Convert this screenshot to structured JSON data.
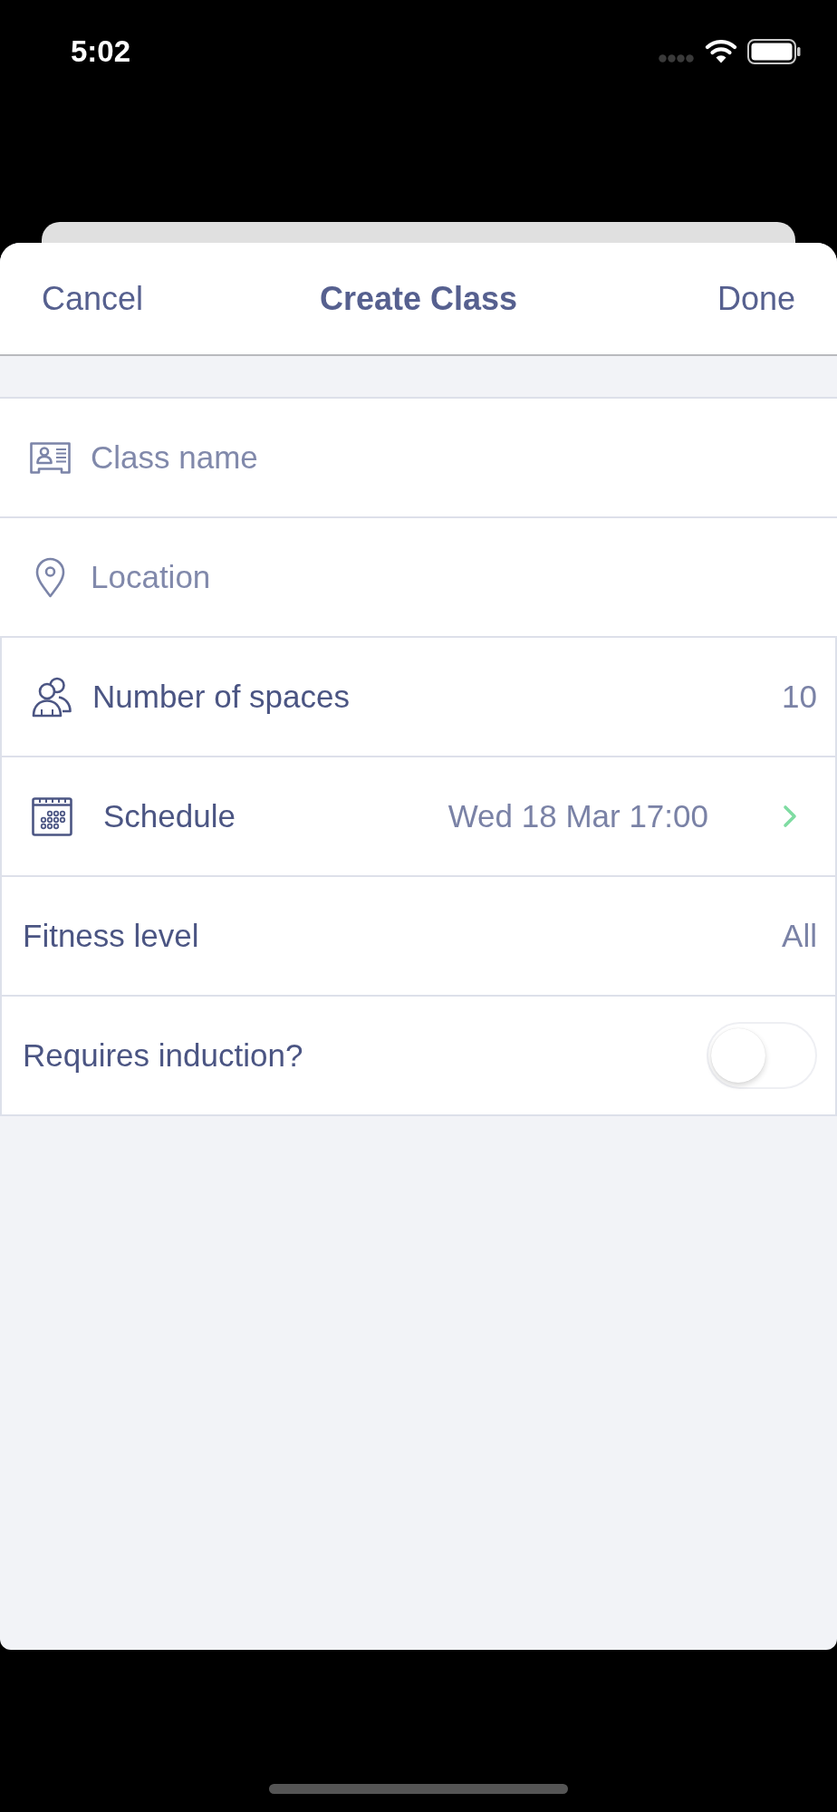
{
  "status_bar": {
    "time": "5:02"
  },
  "header": {
    "cancel": "Cancel",
    "title": "Create Class",
    "done": "Done"
  },
  "text_fields": [
    {
      "placeholder": "Class name"
    },
    {
      "placeholder": "Location"
    }
  ],
  "settings": [
    {
      "kind": "value",
      "label": "Number of spaces",
      "value": "10"
    },
    {
      "kind": "link",
      "label": "Schedule",
      "value": "Wed 18 Mar 17:00"
    },
    {
      "kind": "value",
      "label": "Fitness level",
      "value": "All"
    },
    {
      "kind": "toggle",
      "label": "Requires induction?",
      "on": false
    }
  ]
}
